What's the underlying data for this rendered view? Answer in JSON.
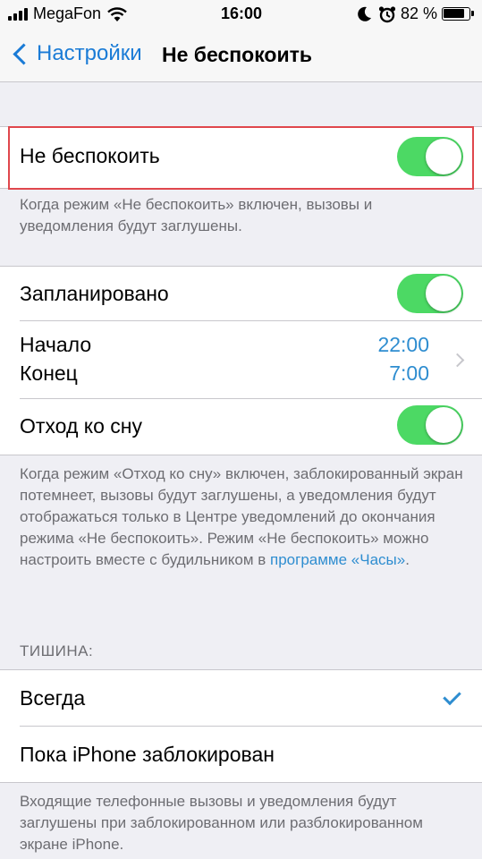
{
  "status_bar": {
    "carrier": "MegaFon",
    "time": "16:00",
    "battery": "82 %",
    "icons": [
      "signal-icon",
      "wifi-icon",
      "moon-icon",
      "alarm-icon",
      "battery-icon"
    ]
  },
  "nav": {
    "back_label": "Настройки",
    "title": "Не беспокоить"
  },
  "dnd": {
    "label": "Не беспокоить",
    "enabled": true,
    "footer": "Когда режим «Не беспокоить» включен, вызовы и уведомления будут заглушены."
  },
  "schedule": {
    "scheduled_label": "Запланировано",
    "scheduled_enabled": true,
    "start_label": "Начало",
    "start_value": "22:00",
    "end_label": "Конец",
    "end_value": "7:00",
    "bedtime_label": "Отход ко сну",
    "bedtime_enabled": true,
    "footer_text": "Когда режим «Отход ко сну» включен, заблокированный экран потемнеет, вызовы будут заглушены, а уведомления будут отображаться только в Центре уведомлений до окончания режима «Не беспокоить». Режим «Не беспокоить» можно настроить вместе с будильником в",
    "footer_link": "программе «Часы»",
    "footer_end": "."
  },
  "silence": {
    "header": "ТИШИНА:",
    "always_label": "Всегда",
    "always_selected": true,
    "locked_label": "Пока iPhone заблокирован",
    "footer": "Входящие телефонные вызовы и уведомления будут заглушены при заблокированном или разблокированном экране iPhone."
  },
  "colors": {
    "accent": "#2e8dd0",
    "switch_on": "#4cd964",
    "background": "#efeff4",
    "highlight": "#e0474c"
  }
}
